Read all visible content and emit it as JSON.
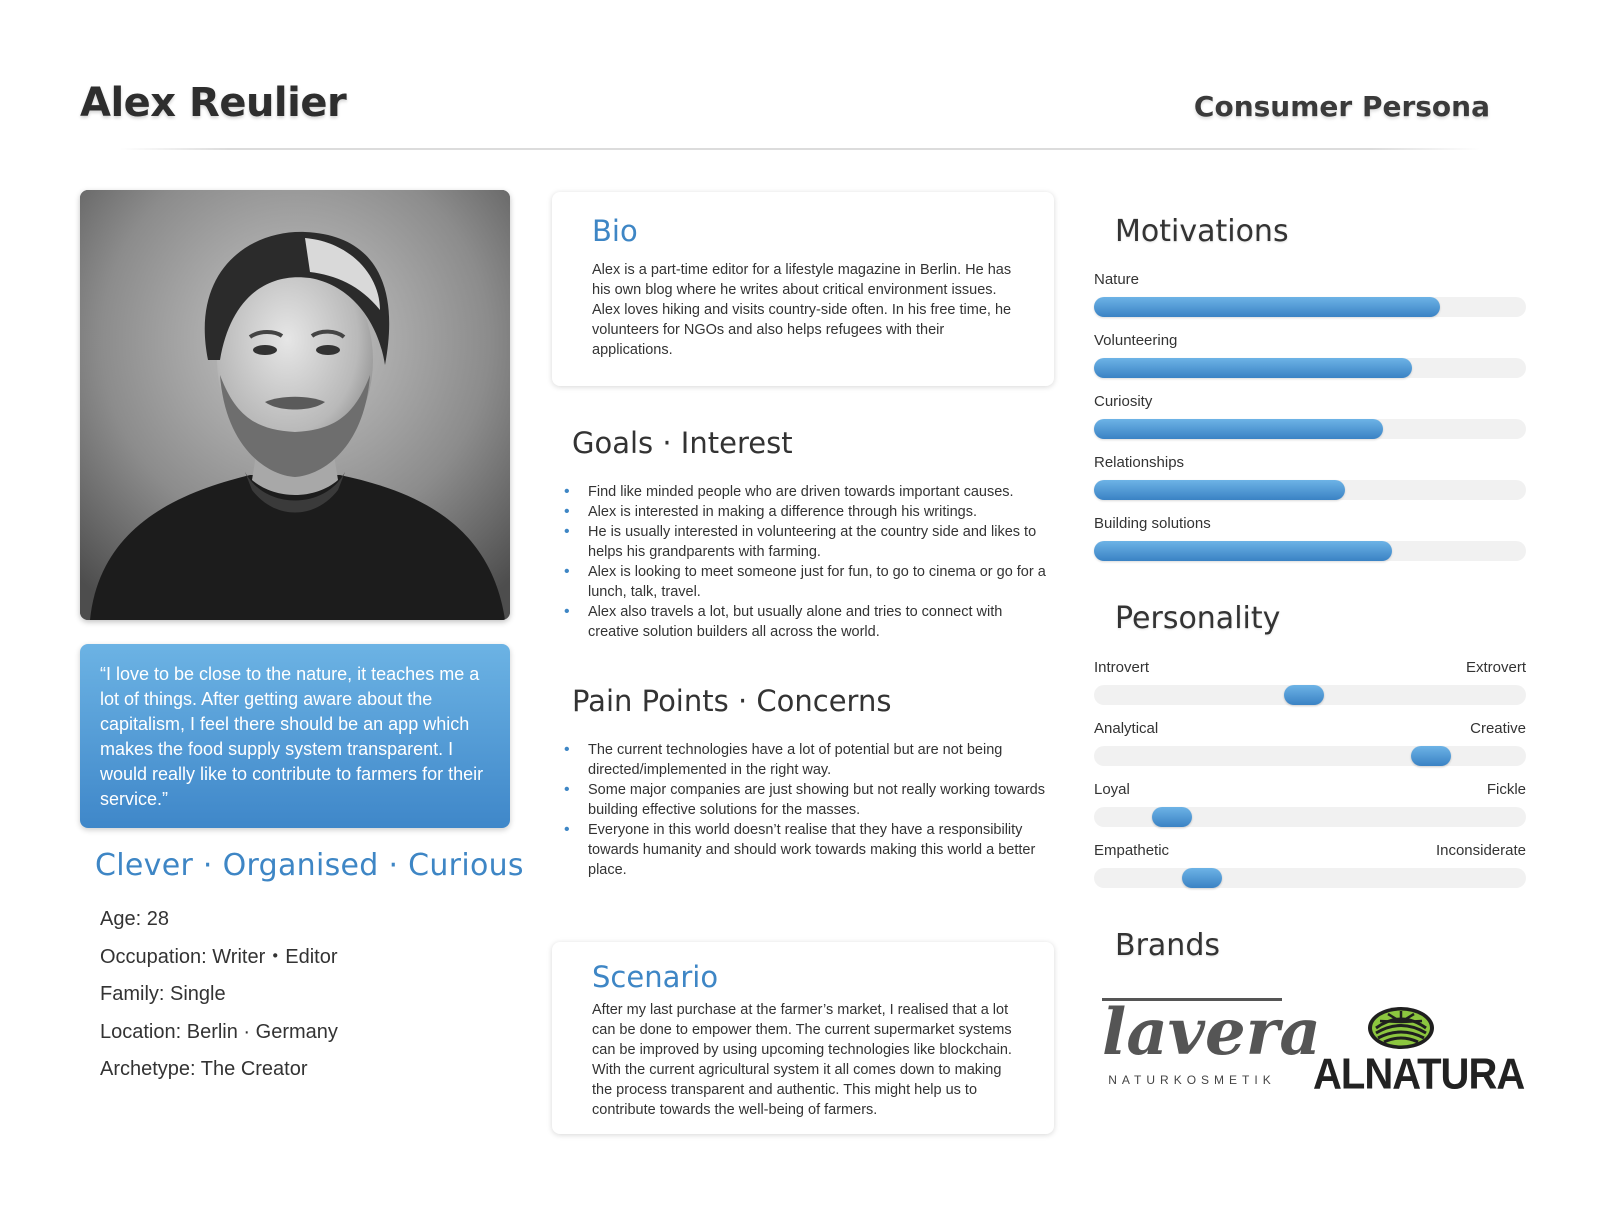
{
  "header": {
    "name": "Alex Reulier",
    "persona_type": "Consumer Persona"
  },
  "profile": {
    "photo_alt": "portrait-photo",
    "quote": "“I love to be close to the nature, it teaches me a lot of things. After getting aware about the capitalism, I feel there should be an app which makes the food supply system transparent. I would really like to contribute to farmers for their service.”",
    "traits": "Clever · Organised · Curious",
    "facts": [
      "Age: 28",
      "Occupation: Writer・Editor",
      "Family: Single",
      "Location: Berlin · Germany",
      "Archetype: The Creator"
    ]
  },
  "bio": {
    "title": "Bio",
    "text": "Alex is a part-time editor for a lifestyle magazine in Berlin. He has his own blog where he writes about critical environment issues. Alex loves hiking and visits country-side often. In his free time, he volunteers for NGOs and also helps refugees with their applications."
  },
  "goals": {
    "title": "Goals · Interest",
    "items": [
      "Find like minded people who are driven towards important causes.",
      "Alex is interested in making a difference through his writings.",
      "He is usually interested in volunteering at the country side and likes to helps his grandparents with farming.",
      "Alex is looking to meet someone just for fun, to go to cinema or go for a lunch, talk, travel.",
      "Alex also travels a lot, but usually alone and tries to connect with creative solution builders all across the world."
    ]
  },
  "pain_points": {
    "title": "Pain Points · Concerns",
    "items": [
      "The current technologies have a lot of potential but are not being directed/implemented in the right way.",
      "Some major companies are just showing but not really working towards building effective solutions for the masses.",
      "Everyone in this world doesn’t realise that they have a responsibility towards humanity and should work towards making this world a better place."
    ]
  },
  "scenario": {
    "title": "Scenario",
    "text": "After my last purchase at the farmer’s market, I realised that a lot can be done to empower them. The current supermarket systems can be improved by using upcoming technologies like blockchain. With the current agricultural system it all comes down to making the process transparent and authentic. This might help us to contribute towards the well-being of farmers."
  },
  "motivations": {
    "title": "Motivations",
    "items": [
      {
        "label": "Nature",
        "level": 0.8
      },
      {
        "label": "Volunteering",
        "level": 0.735
      },
      {
        "label": "Curiosity",
        "level": 0.67
      },
      {
        "label": "Relationships",
        "level": 0.58
      },
      {
        "label": "Building solutions",
        "level": 0.69
      }
    ]
  },
  "personality": {
    "title": "Personality",
    "items": [
      {
        "left": "Introvert",
        "right": "Extrovert",
        "level": 0.485
      },
      {
        "left": "Analytical",
        "right": "Creative",
        "level": 0.78
      },
      {
        "left": "Loyal",
        "right": "Fickle",
        "level": 0.18
      },
      {
        "left": "Empathetic",
        "right": "Inconsiderate",
        "level": 0.25
      }
    ]
  },
  "brands": {
    "title": "Brands",
    "lavera": {
      "word": "lavera",
      "sub": "NATURKOSMETIK"
    },
    "alnatura": {
      "word": "ALNATURA"
    }
  },
  "colors": {
    "accent": "#3e86c5",
    "bar_light": "#6db3e6",
    "bar_dark": "#3a82c4",
    "track": "#f1f1f1"
  }
}
